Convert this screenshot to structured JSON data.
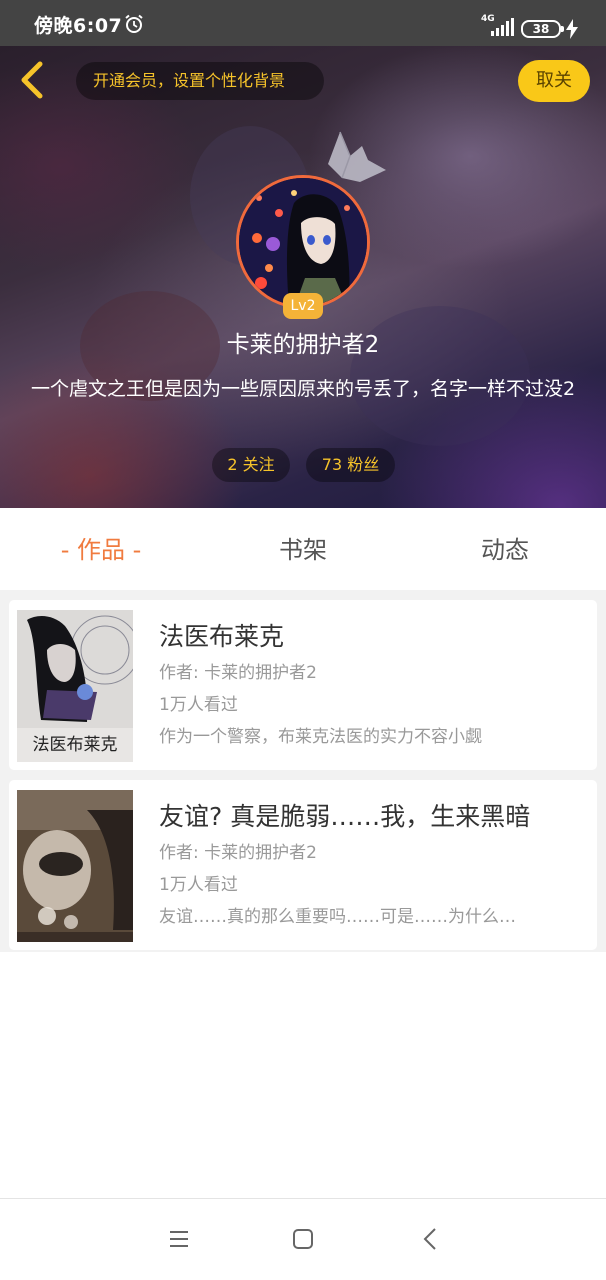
{
  "status_bar": {
    "time": "傍晚6:07",
    "network": "4G",
    "battery": "38",
    "icons": [
      "alarm-icon",
      "signal-icon",
      "battery-icon",
      "charge-icon"
    ]
  },
  "header": {
    "back_icon": "chevron-left-icon",
    "vip_prompt": "开通会员，设置个性化背景",
    "follow_button": "取关",
    "crown_icon": "crown-icon",
    "level": "Lv2",
    "username": "卡莱的拥护者2",
    "bio": "一个虐文之王但是因为一些原因原来的号丢了，名字一样不过没2",
    "stats": {
      "following": "2 关注",
      "fans": "73 粉丝"
    }
  },
  "tabs": [
    {
      "label": "- 作品 -",
      "active": true
    },
    {
      "label": "书架",
      "active": false
    },
    {
      "label": "动态",
      "active": false
    }
  ],
  "books": [
    {
      "title": "法医布莱克",
      "author": "作者: 卡莱的拥护者2",
      "views": "1万人看过",
      "desc": "作为一个警察，布莱克法医的实力不容小觑",
      "cover_text": "法医布莱克"
    },
    {
      "title": "友谊? 真是脆弱……我，生来黑暗",
      "author": "作者: 卡莱的拥护者2",
      "views": "1万人看过",
      "desc": "友谊……真的那么重要吗……可是……为什么…"
    }
  ],
  "colors": {
    "accent": "#f07b3f",
    "gold": "#f6c32a",
    "follow_button_bg": "#f9c818",
    "avatar_border": "#f06a3c",
    "level_badge": "#f4b338"
  },
  "nav_bar": {
    "icons": [
      "menu-icon",
      "home-square-icon",
      "back-triangle-icon"
    ]
  }
}
